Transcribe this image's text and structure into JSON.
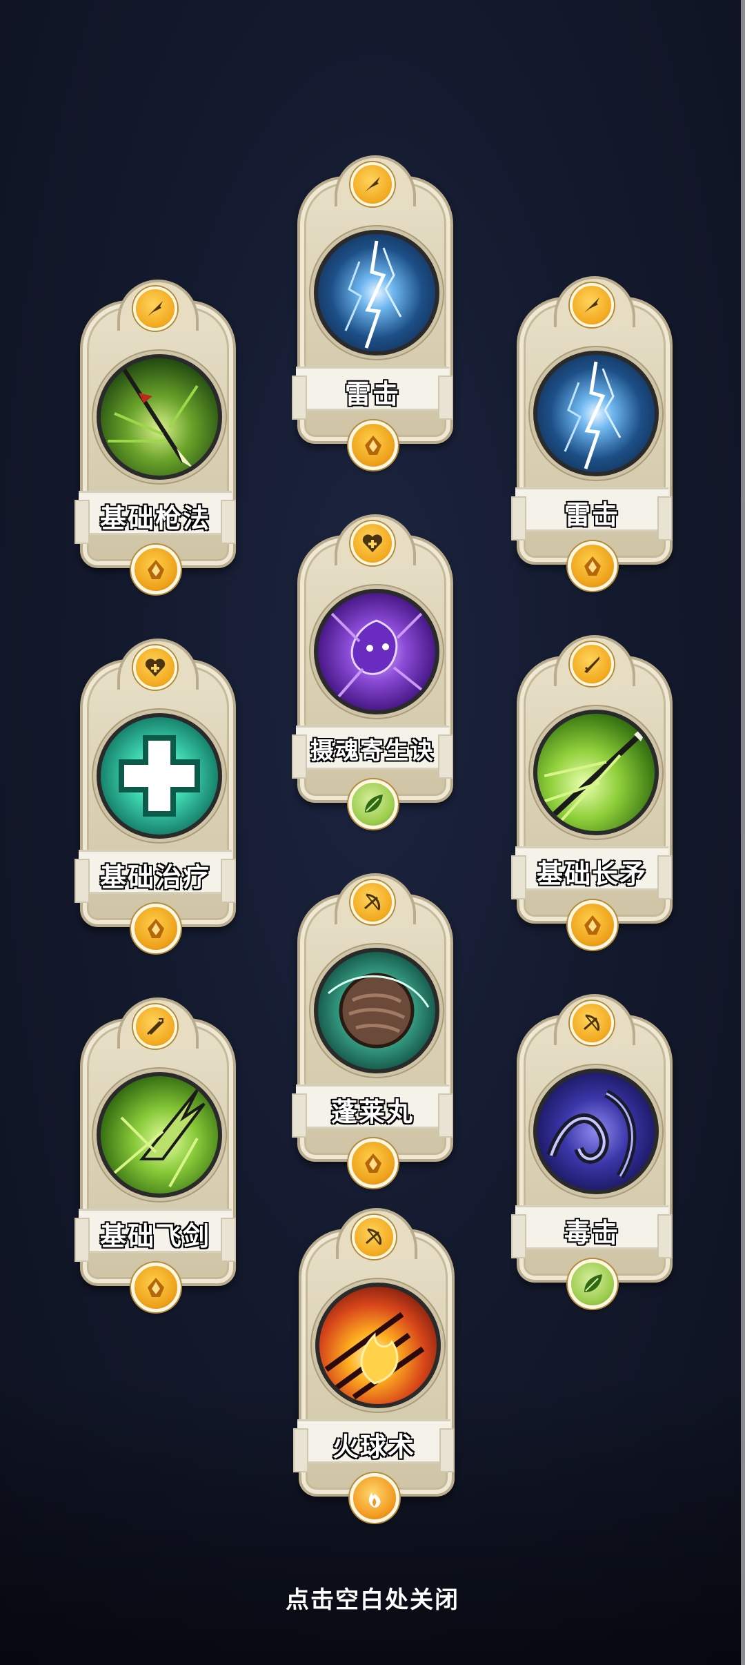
{
  "cards": [
    {
      "id": "c1",
      "name": "雷击",
      "top_icon": "spear-icon",
      "skill_icon": "lightning-icon",
      "element": "earth-gold-icon",
      "element_color": "#eea21b"
    },
    {
      "id": "c2",
      "name": "基础枪法",
      "top_icon": "spear-icon",
      "skill_icon": "spear-strike-icon",
      "element": "earth-gold-icon",
      "element_color": "#eea21b"
    },
    {
      "id": "c3",
      "name": "雷击",
      "top_icon": "spear-icon",
      "skill_icon": "lightning-icon",
      "element": "earth-gold-icon",
      "element_color": "#eea21b"
    },
    {
      "id": "c4",
      "name": "摄魂寄生诀",
      "top_icon": "heart-plus-icon",
      "skill_icon": "purple-soul-icon",
      "element": "leaf-green-icon",
      "element_color": "#9ccc4d"
    },
    {
      "id": "c5",
      "name": "基础治疗",
      "top_icon": "heart-plus-icon",
      "skill_icon": "cross-heal-icon",
      "element": "earth-gold-icon",
      "element_color": "#eea21b"
    },
    {
      "id": "c6",
      "name": "基础长矛",
      "top_icon": "sword-icon",
      "skill_icon": "green-spear-icon",
      "element": "earth-gold-icon",
      "element_color": "#eea21b"
    },
    {
      "id": "c7",
      "name": "蓬莱丸",
      "top_icon": "bow-icon",
      "skill_icon": "pill-orb-icon",
      "element": "earth-gold-icon",
      "element_color": "#eea21b"
    },
    {
      "id": "c8",
      "name": "基础飞剑",
      "top_icon": "double-sword-icon",
      "skill_icon": "flying-sword-icon",
      "element": "earth-gold-icon",
      "element_color": "#eea21b"
    },
    {
      "id": "c9",
      "name": "毒击",
      "top_icon": "bow-icon",
      "skill_icon": "poison-vine-icon",
      "element": "leaf-green-icon",
      "element_color": "#9ccc4d"
    },
    {
      "id": "c10",
      "name": "火球术",
      "top_icon": "bow-icon",
      "skill_icon": "fireball-icon",
      "element": "fire-icon",
      "element_color": "#f29a1f"
    }
  ],
  "close_hint": "点击空白处关闭"
}
